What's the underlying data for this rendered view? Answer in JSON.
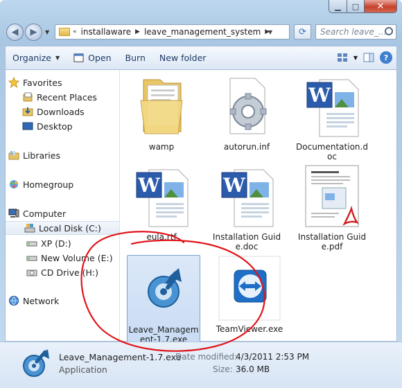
{
  "window": {
    "min_glyph": "▁",
    "max_glyph": "□",
    "close_glyph": "✕"
  },
  "address": {
    "history_glyph": "«",
    "path": [
      "installaware",
      "leave_management_system"
    ],
    "search_placeholder": "Search leave_...",
    "refresh_glyph": "⟳"
  },
  "toolbar": {
    "organize": "Organize",
    "open": "Open",
    "burn": "Burn",
    "new_folder": "New folder"
  },
  "nav": {
    "favorites": "Favorites",
    "recent": "Recent Places",
    "downloads": "Downloads",
    "desktop": "Desktop",
    "libraries": "Libraries",
    "homegroup": "Homegroup",
    "computer": "Computer",
    "local_disk": "Local Disk (C:)",
    "xp": "XP (D:)",
    "new_volume": "New Volume (E:)",
    "cd_drive": "CD Drive (H:)",
    "network": "Network"
  },
  "files": [
    {
      "name": "wamp",
      "icon": "folder-icon"
    },
    {
      "name": "autorun.inf",
      "icon": "settings-file-icon"
    },
    {
      "name": "Documentation.doc",
      "icon": "word-doc-icon"
    },
    {
      "name": "eula.rtf",
      "icon": "word-doc-icon"
    },
    {
      "name": "Installation Guide.doc",
      "icon": "word-doc-icon"
    },
    {
      "name": "Installation Guide.pdf",
      "icon": "pdf-icon"
    },
    {
      "name": "Leave_Management-1.7.exe",
      "icon": "installer-icon"
    },
    {
      "name": "TeamViewer.exe",
      "icon": "teamviewer-icon"
    }
  ],
  "details": {
    "name": "Leave_Management-1.7.exe",
    "type": "Application",
    "modified_label": "Date modified:",
    "modified_value": "4/3/2011 2:53 PM",
    "size_label": "Size:",
    "size_value": "36.0 MB"
  },
  "colors": {
    "annotation": "#e0141a",
    "selection": "#c9dcf4",
    "link": "#1e3a66"
  }
}
